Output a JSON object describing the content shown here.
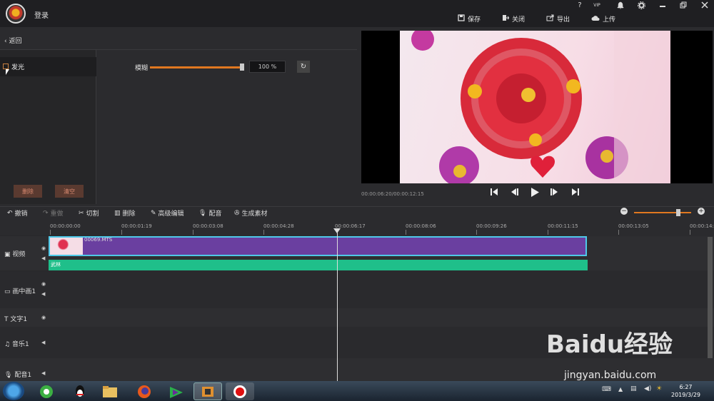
{
  "topbar": {
    "login_label": "登录",
    "icons": [
      "help-icon",
      "vip-icon",
      "bell-icon",
      "settings-icon",
      "minimize-icon",
      "restore-icon",
      "close-icon"
    ],
    "help_glyph": "?",
    "vip_glyph": "VIP",
    "actions": {
      "save": "保存",
      "close": "关闭",
      "export": "导出",
      "upload": "上传"
    }
  },
  "left": {
    "back_label": "返回",
    "effect_item": "发光",
    "delete_btn": "删除",
    "clear_btn": "清空",
    "blur_label": "模糊",
    "blur_value": "100 %",
    "blur_level": 1.0
  },
  "preview": {
    "timecode": "00:00:06:20/00:00:12:15"
  },
  "toolbar": {
    "undo": "撤销",
    "redo": "重做",
    "cut": "切割",
    "delete": "删除",
    "advanced": "高级编辑",
    "dub": "配音",
    "generate": "生成素材"
  },
  "ruler": {
    "ticks": [
      "00:00:00:00",
      "00:00:01:19",
      "00:00:03:08",
      "00:00:04:28",
      "00:00:06:17",
      "00:00:08:06",
      "00:00:09:26",
      "00:00:11:15",
      "00:00:13:05",
      "00:00:14:"
    ]
  },
  "tracks": {
    "video": "视频",
    "pip": "画中画1",
    "text": "文字1",
    "music": "音乐1",
    "dub": "配音1"
  },
  "clips": {
    "video_clip": "00069.MTS",
    "fx_clip": "武林"
  },
  "taskbar": {
    "time": "6:27",
    "date": "2019/3/29"
  },
  "watermark": {
    "brand": "Baidu经验",
    "url": "jingyan.baidu.com"
  }
}
